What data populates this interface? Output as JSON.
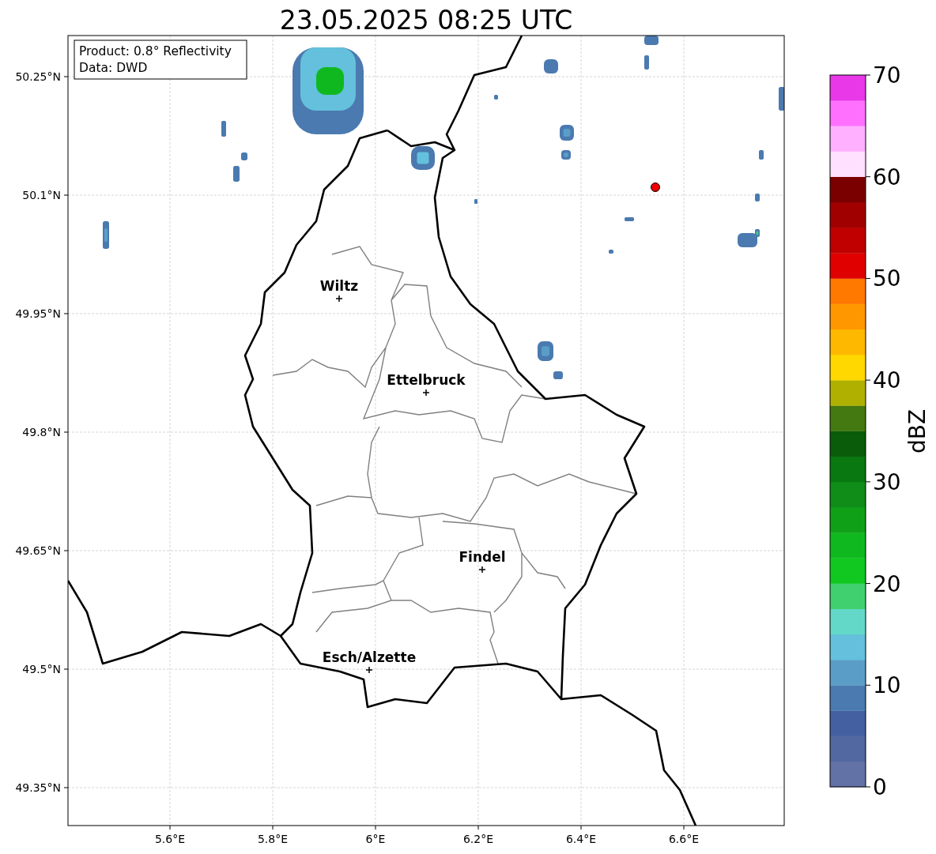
{
  "title": "23.05.2025 08:25 UTC",
  "info_box": [
    "Product: 0.8° Reflectivity",
    "Data: DWD"
  ],
  "map": {
    "lat_ticks": [
      "50.25°N",
      "50.1°N",
      "49.95°N",
      "49.8°N",
      "49.65°N",
      "49.5°N",
      "49.35°N"
    ],
    "lon_ticks": [
      "5.6°E",
      "5.8°E",
      "6°E",
      "6.2°E",
      "6.4°E",
      "6.6°E"
    ],
    "cities": [
      {
        "name": "Wiltz"
      },
      {
        "name": "Ettelbruck"
      },
      {
        "name": "Findel"
      },
      {
        "name": "Esch/Alzette"
      }
    ]
  },
  "colorbar": {
    "label": "dBZ",
    "ticks": [
      "70",
      "60",
      "50",
      "40",
      "30",
      "20",
      "10",
      "0"
    ],
    "bands": [
      {
        "color": "#6272a6"
      },
      {
        "color": "#5268a0"
      },
      {
        "color": "#4460a0"
      },
      {
        "color": "#4a7ab0"
      },
      {
        "color": "#5a9ec8"
      },
      {
        "color": "#64c0dc"
      },
      {
        "color": "#64d8c8"
      },
      {
        "color": "#40d070"
      },
      {
        "color": "#10c820"
      },
      {
        "color": "#10b820"
      },
      {
        "color": "#10a018"
      },
      {
        "color": "#108c18"
      },
      {
        "color": "#0a7810"
      },
      {
        "color": "#0a5c0a"
      },
      {
        "color": "#447810"
      },
      {
        "color": "#b0b000"
      },
      {
        "color": "#ffd800"
      },
      {
        "color": "#ffb800"
      },
      {
        "color": "#ff9800"
      },
      {
        "color": "#ff7800"
      },
      {
        "color": "#e00000"
      },
      {
        "color": "#c00000"
      },
      {
        "color": "#a00000"
      },
      {
        "color": "#7a0000"
      },
      {
        "color": "#ffe0ff"
      },
      {
        "color": "#ffb0ff"
      },
      {
        "color": "#ff70ff"
      },
      {
        "color": "#e838e8"
      }
    ]
  }
}
